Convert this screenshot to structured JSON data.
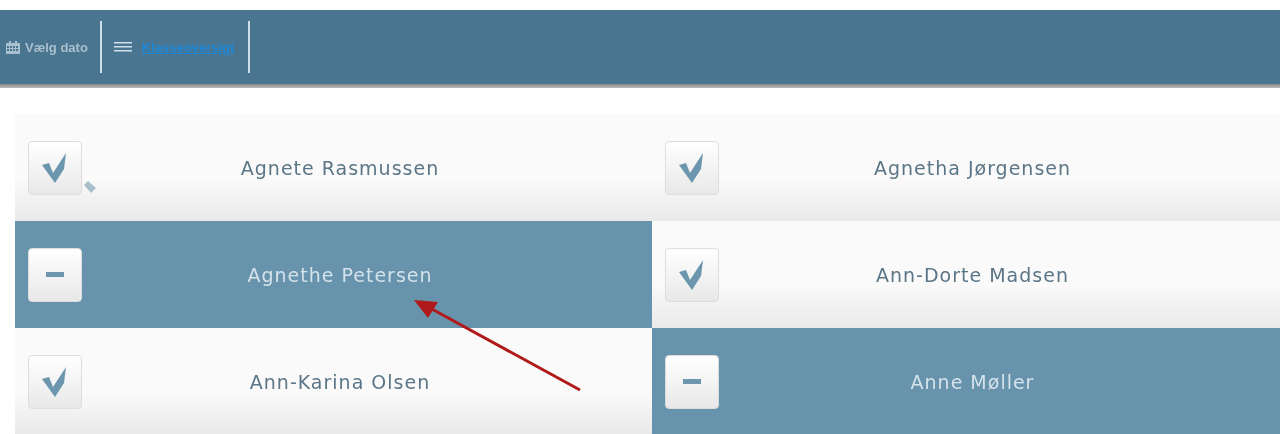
{
  "toolbar": {
    "date_button": "Vælg dato",
    "class_link": "Klasseoversigt"
  },
  "students": [
    {
      "name": "Agnete Rasmussen",
      "present": true,
      "tagged": true
    },
    {
      "name": "Agnetha Jørgensen",
      "present": true,
      "tagged": false
    },
    {
      "name": "Agnethe Petersen",
      "present": false,
      "tagged": false
    },
    {
      "name": "Ann-Dorte Madsen",
      "present": true,
      "tagged": false
    },
    {
      "name": "Ann-Karina Olsen",
      "present": true,
      "tagged": false
    },
    {
      "name": "Anne Møller",
      "present": false,
      "tagged": false
    }
  ]
}
